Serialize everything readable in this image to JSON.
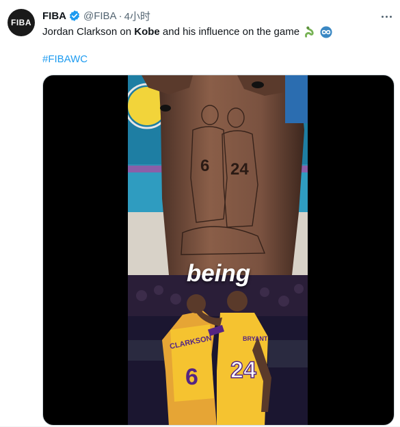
{
  "account": {
    "avatar_text": "FIBA",
    "display_name": "FIBA",
    "handle": "@FIBA",
    "separator": "·",
    "time": "4小时"
  },
  "tweet": {
    "text_before": "Jordan Clarkson on ",
    "text_bold": "Kobe",
    "text_after": " and his influence on the game",
    "emojis": [
      "snake-emoji",
      "infinity-emoji"
    ],
    "hashtag": "#FIBAWC"
  },
  "media": {
    "caption": "being",
    "top_frame": "tattoo-of-kobe-and-gianna",
    "bottom_frame": "clarkson-and-kobe-lakers-jerseys",
    "jersey_left": {
      "name": "CLARKSON",
      "number": "6"
    },
    "jersey_right": {
      "name": "BRYANT",
      "number": "24"
    },
    "tattoo_numbers": [
      "6",
      "24"
    ]
  },
  "colors": {
    "link": "#1d9bf0",
    "verified": "#1d9bf0",
    "lakers_gold": "#f5c330",
    "lakers_purple": "#552583"
  }
}
